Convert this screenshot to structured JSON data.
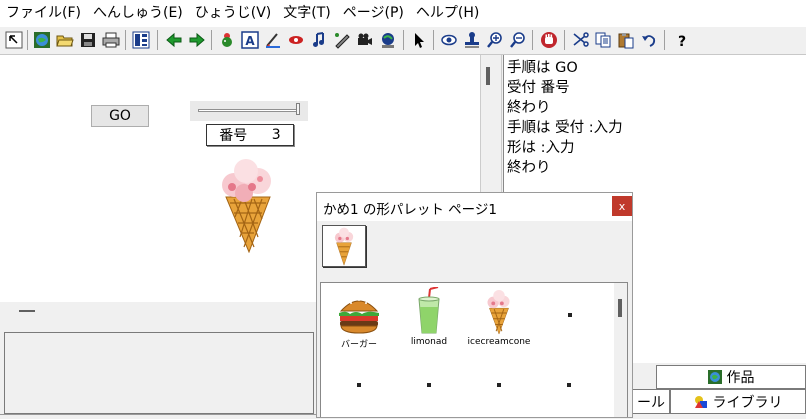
{
  "menu": [
    "ファイル(F)",
    "へんしゅう(E)",
    "ひょうじ(V)",
    "文字(T)",
    "ページ(P)",
    "ヘルプ(H)"
  ],
  "toolbar": {
    "icons": [
      "arrow-select-icon",
      "globe-icon",
      "open-folder-icon",
      "save-icon",
      "print-icon",
      "layout-icon",
      "back-arrow-icon",
      "forward-arrow-icon",
      "character-icon",
      "text-a-icon",
      "brush-icon",
      "eye-mask-icon",
      "music-note-icon",
      "pen-icon",
      "video-icon",
      "network-icon",
      "pointer-icon",
      "eye-icon",
      "stamp-icon",
      "zoom-in-icon",
      "zoom-out-icon",
      "stop-hand-icon",
      "scissors-icon",
      "copy-icon",
      "paste-icon",
      "undo-icon",
      "help-icon"
    ]
  },
  "stage": {
    "go_button": "GO",
    "field_label": "番号",
    "field_value": "3"
  },
  "script_lines": [
    "手順は GO",
    "受付 番号",
    "終わり",
    "手順は 受付 :入力",
    "形は :入力",
    "終わり"
  ],
  "tabs": {
    "works": "作品",
    "library": "ライブラリ",
    "tool_partial": "ール"
  },
  "palette": {
    "title": "かめ1 の形パレット ページ1",
    "close": "x",
    "items": [
      {
        "name": "バーガー",
        "icon": "burger-icon"
      },
      {
        "name": "limonad",
        "icon": "lemonade-icon"
      },
      {
        "name": "icecreamcone",
        "icon": "icecream-icon"
      }
    ]
  },
  "colors": {
    "cone": "#e8a33a",
    "scoop": "#f7c9cf",
    "close": "#c0392b"
  }
}
